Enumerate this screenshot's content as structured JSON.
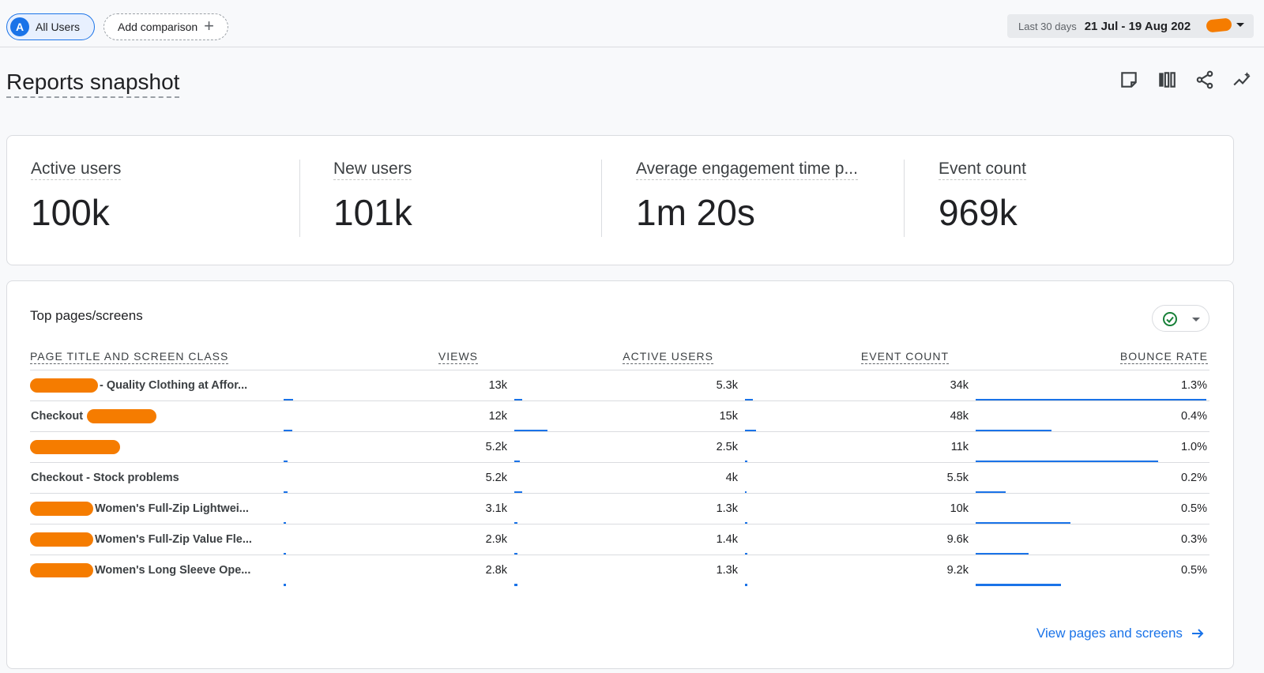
{
  "topbar": {
    "all_users": {
      "avatar_letter": "A",
      "label": "All Users"
    },
    "add_comparison": {
      "label": "Add comparison",
      "icon": "plus-icon"
    },
    "date_range": {
      "label": "Last 30 days",
      "value": "21 Jul - 19 Aug 202"
    }
  },
  "page": {
    "title": "Reports snapshot",
    "icons": [
      "customize-note-icon",
      "compare-columns-icon",
      "share-icon",
      "insights-icon"
    ]
  },
  "kpis": [
    {
      "name": "Active users",
      "value": "100k"
    },
    {
      "name": "New users",
      "value": "101k"
    },
    {
      "name": "Average engagement time p...",
      "value": "1m 20s"
    },
    {
      "name": "Event count",
      "value": "969k"
    }
  ],
  "table": {
    "title": "Top pages/screens",
    "columns": [
      "PAGE TITLE AND SCREEN CLASS",
      "VIEWS",
      "ACTIVE USERS",
      "EVENT COUNT",
      "BOUNCE RATE"
    ],
    "rows": [
      {
        "page": "- Quality Clothing at Affor...",
        "views": "13k",
        "active_users": "5.3k",
        "event_count": "34k",
        "bounce_rate": "1.3%",
        "views_frac": 0.043,
        "users_frac": 0.035,
        "events_frac": 0.035,
        "bounce_frac": 1.0
      },
      {
        "page": "Checkout",
        "views": "12k",
        "active_users": "15k",
        "event_count": "48k",
        "bounce_rate": "0.4%",
        "views_frac": 0.04,
        "users_frac": 0.148,
        "events_frac": 0.05,
        "bounce_frac": 0.33
      },
      {
        "page": "",
        "views": "5.2k",
        "active_users": "2.5k",
        "event_count": "11k",
        "bounce_rate": "1.0%",
        "views_frac": 0.017,
        "users_frac": 0.025,
        "events_frac": 0.011,
        "bounce_frac": 0.79
      },
      {
        "page": "Checkout - Stock problems",
        "views": "5.2k",
        "active_users": "4k",
        "event_count": "5.5k",
        "bounce_rate": "0.2%",
        "views_frac": 0.017,
        "users_frac": 0.035,
        "events_frac": 0.006,
        "bounce_frac": 0.13
      },
      {
        "page": "Women's Full-Zip Lightwei...",
        "views": "3.1k",
        "active_users": "1.3k",
        "event_count": "10k",
        "bounce_rate": "0.5%",
        "views_frac": 0.01,
        "users_frac": 0.013,
        "events_frac": 0.01,
        "bounce_frac": 0.41
      },
      {
        "page": "Women's Full-Zip Value Fle...",
        "views": "2.9k",
        "active_users": "1.4k",
        "event_count": "9.6k",
        "bounce_rate": "0.3%",
        "views_frac": 0.01,
        "users_frac": 0.014,
        "events_frac": 0.01,
        "bounce_frac": 0.23
      },
      {
        "page": "Women's Long Sleeve Ope...",
        "views": "2.8k",
        "active_users": "1.3k",
        "event_count": "9.2k",
        "bounce_rate": "0.5%",
        "views_frac": 0.009,
        "users_frac": 0.013,
        "events_frac": 0.01,
        "bounce_frac": 0.37
      }
    ],
    "view_link": "View pages and screens"
  },
  "colors": {
    "accent": "#1a73e8",
    "redaction": "#f57c00",
    "border": "#dadce0"
  }
}
